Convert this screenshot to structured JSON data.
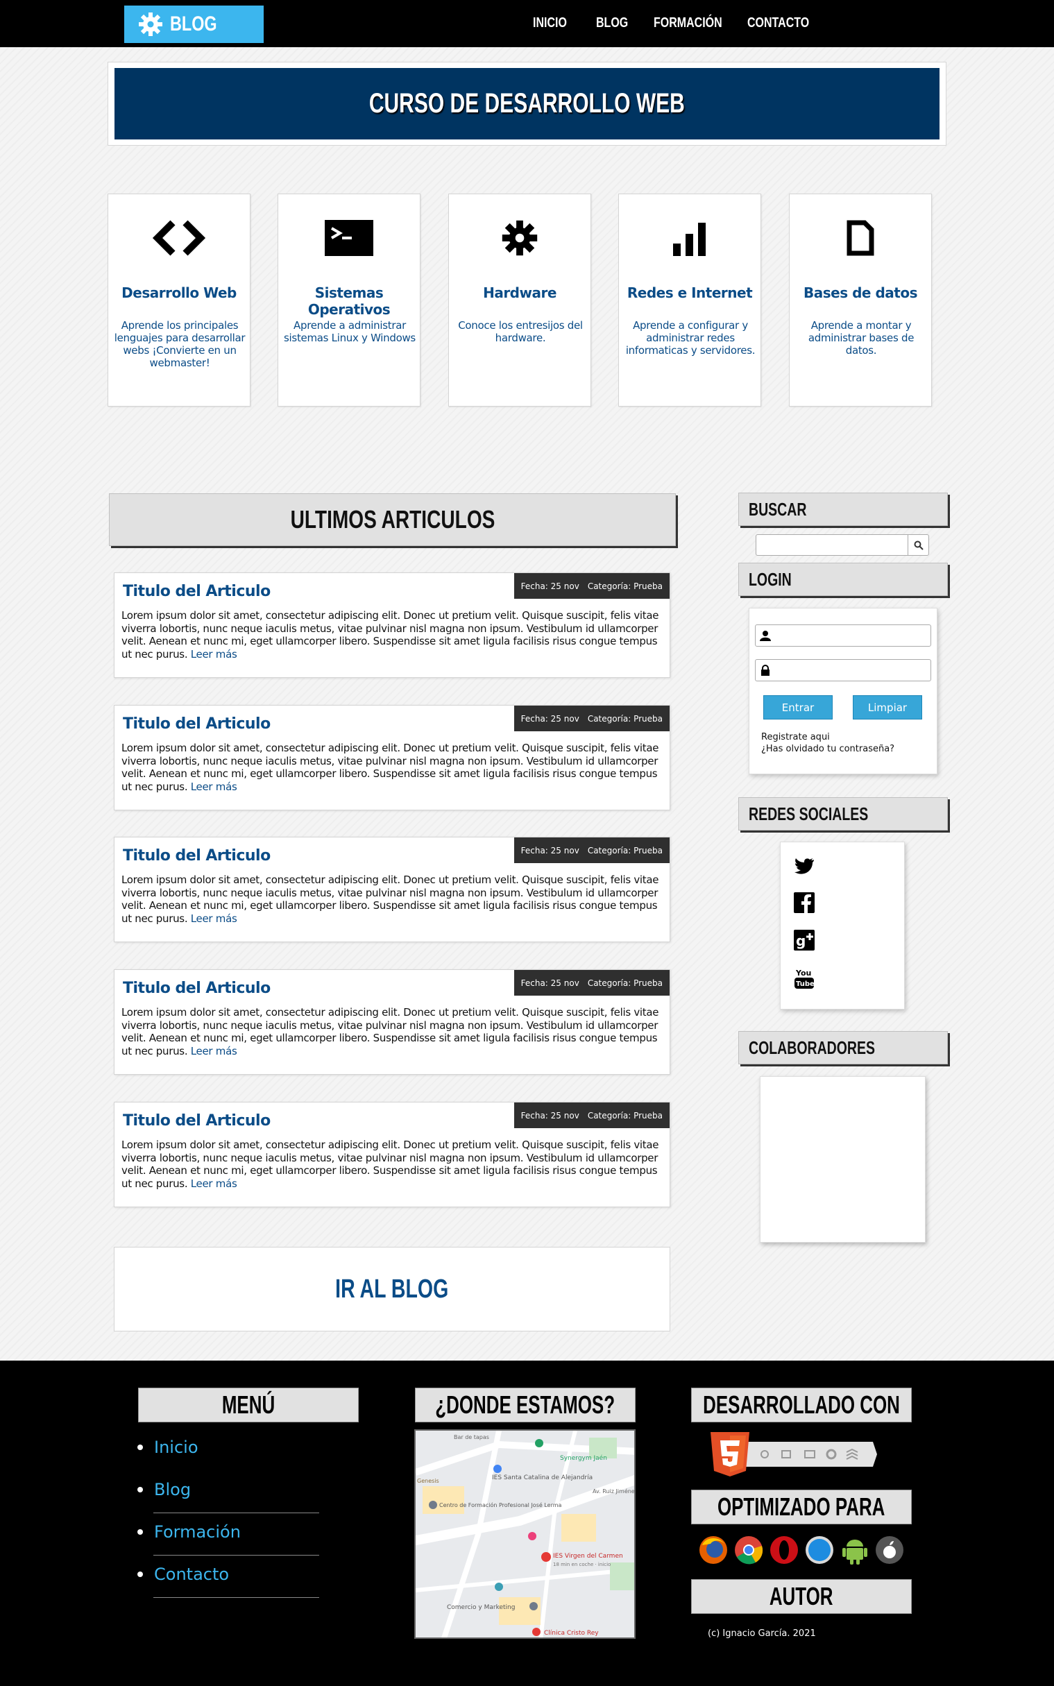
{
  "nav": {
    "logo_label": "BLOG",
    "items": [
      "INICIO",
      "BLOG",
      "FORMACIÓN",
      "CONTACTO"
    ]
  },
  "banner": {
    "title": "CURSO DE DESARROLLO WEB"
  },
  "features": [
    {
      "icon": "code-icon",
      "title": "Desarrollo Web",
      "desc": "Aprende los principales lenguajes para desarrollar webs ¡Convierte en un webmaster!"
    },
    {
      "icon": "terminal-icon",
      "title": "Sistemas Operativos",
      "desc": "Aprende a administrar sistemas Linux y Windows"
    },
    {
      "icon": "gear-icon",
      "title": "Hardware",
      "desc": "Conoce los entresijos del hardware."
    },
    {
      "icon": "signal-bars-icon",
      "title": "Redes e Internet",
      "desc": "Aprende a configurar y administrar redes informaticas y servidores."
    },
    {
      "icon": "document-icon",
      "title": "Bases de datos",
      "desc": "Aprende a montar y administrar bases de datos."
    }
  ],
  "articles_header": "ULTIMOS ARTICULOS",
  "articles": [
    {
      "title": "Titulo del Articulo",
      "date": "Fecha: 25 nov",
      "category": "Categoría: Prueba",
      "body": "Lorem ipsum dolor sit amet, consectetur adipiscing elit. Donec ut pretium velit. Quisque suscipit, felis vitae viverra lobortis, nunc neque iaculis metus, vitae pulvinar nisl magna non ipsum. Vestibulum id ullamcorper velit. Aenean et nunc mi, eget ullamcorper libero. Suspendisse sit amet ligula facilisis risus congue tempus ut nec purus.",
      "more": "Leer más"
    },
    {
      "title": "Titulo del Articulo",
      "date": "Fecha: 25 nov",
      "category": "Categoría: Prueba",
      "body": "Lorem ipsum dolor sit amet, consectetur adipiscing elit. Donec ut pretium velit. Quisque suscipit, felis vitae viverra lobortis, nunc neque iaculis metus, vitae pulvinar nisl magna non ipsum. Vestibulum id ullamcorper velit. Aenean et nunc mi, eget ullamcorper libero. Suspendisse sit amet ligula facilisis risus congue tempus ut nec purus.",
      "more": "Leer más"
    },
    {
      "title": "Titulo del Articulo",
      "date": "Fecha: 25 nov",
      "category": "Categoría: Prueba",
      "body": "Lorem ipsum dolor sit amet, consectetur adipiscing elit. Donec ut pretium velit. Quisque suscipit, felis vitae viverra lobortis, nunc neque iaculis metus, vitae pulvinar nisl magna non ipsum. Vestibulum id ullamcorper velit. Aenean et nunc mi, eget ullamcorper libero. Suspendisse sit amet ligula facilisis risus congue tempus ut nec purus.",
      "more": "Leer más"
    },
    {
      "title": "Titulo del Articulo",
      "date": "Fecha: 25 nov",
      "category": "Categoría: Prueba",
      "body": "Lorem ipsum dolor sit amet, consectetur adipiscing elit. Donec ut pretium velit. Quisque suscipit, felis vitae viverra lobortis, nunc neque iaculis metus, vitae pulvinar nisl magna non ipsum. Vestibulum id ullamcorper velit. Aenean et nunc mi, eget ullamcorper libero. Suspendisse sit amet ligula facilisis risus congue tempus ut nec purus.",
      "more": "Leer más"
    },
    {
      "title": "Titulo del Articulo",
      "date": "Fecha: 25 nov",
      "category": "Categoría: Prueba",
      "body": "Lorem ipsum dolor sit amet, consectetur adipiscing elit. Donec ut pretium velit. Quisque suscipit, felis vitae viverra lobortis, nunc neque iaculis metus, vitae pulvinar nisl magna non ipsum. Vestibulum id ullamcorper velit. Aenean et nunc mi, eget ullamcorper libero. Suspendisse sit amet ligula facilisis risus congue tempus ut nec purus.",
      "more": "Leer más"
    }
  ],
  "go_blog": "IR AL BLOG",
  "sidebar": {
    "search_title": "BUSCAR",
    "search_value": "",
    "login_title": "LOGIN",
    "login": {
      "user_value": "",
      "password_value": "",
      "enter_label": "Entrar",
      "clear_label": "Limpiar",
      "register_link": "Registrate aqui",
      "forgot_link": "¿Has olvidado tu contraseña?"
    },
    "social_title": "REDES SOCIALES",
    "social": [
      "twitter-icon",
      "facebook-icon",
      "google-plus-icon",
      "youtube-icon"
    ],
    "collab_title": "COLABORADORES"
  },
  "footer": {
    "menu_title": "MENÚ",
    "menu_items": [
      "Inicio",
      "Blog",
      "Formación",
      "Contacto"
    ],
    "location_title": "¿DONDE ESTAMOS?",
    "map_labels": [
      "Bar de tapas",
      "Synergym Jaén",
      "IES Santa Catalina de Alejandría",
      "Av. Ruiz Jiménez",
      "Centro de Formación Profesional José Lerma",
      "IES Virgen del Carmen",
      "18 min en coche · inicio",
      "Comercio y Marketing",
      "Clínica Cristo Rey",
      "Genesis"
    ],
    "developed_title": "DESARROLLADO CON",
    "optimized_title": "OPTIMIZADO PARA",
    "browsers": [
      "firefox-icon",
      "chrome-icon",
      "opera-icon",
      "safari-icon",
      "android-icon",
      "apple-icon"
    ],
    "author_title": "AUTOR",
    "credit": "(c) Ignacio García. 2021"
  },
  "colors": {
    "accent": "#3cb6ee",
    "dark_blue": "#003461",
    "link_blue": "#0b4c87",
    "meta_bg": "#2f2f2f"
  }
}
